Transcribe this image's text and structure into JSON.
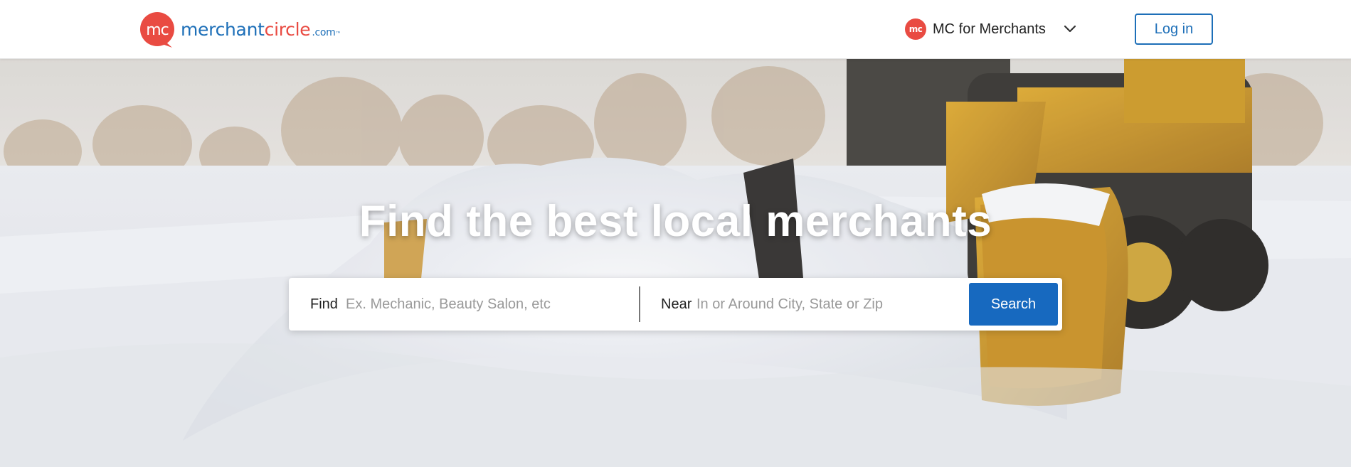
{
  "header": {
    "logo": {
      "badge_text": "mc",
      "word1": "merchant",
      "word2": "circle",
      "suffix": ".com",
      "tm": "™"
    },
    "merchants_menu": {
      "icon_text": "mc",
      "label": "MC for Merchants",
      "chevron_icon": "chevron-down-icon"
    },
    "login_label": "Log in"
  },
  "hero": {
    "title": "Find the best local merchants",
    "background_description_icon": "snow-plow-hero-image",
    "search": {
      "find_label": "Find",
      "find_placeholder": "Ex. Mechanic, Beauty Salon, etc",
      "find_value": "",
      "near_label": "Near",
      "near_placeholder": "In or Around City, State or Zip",
      "near_value": "",
      "button_label": "Search"
    }
  },
  "colors": {
    "brand_blue": "#1d6fb8",
    "brand_red": "#e94b42",
    "search_button": "#1769bf"
  }
}
